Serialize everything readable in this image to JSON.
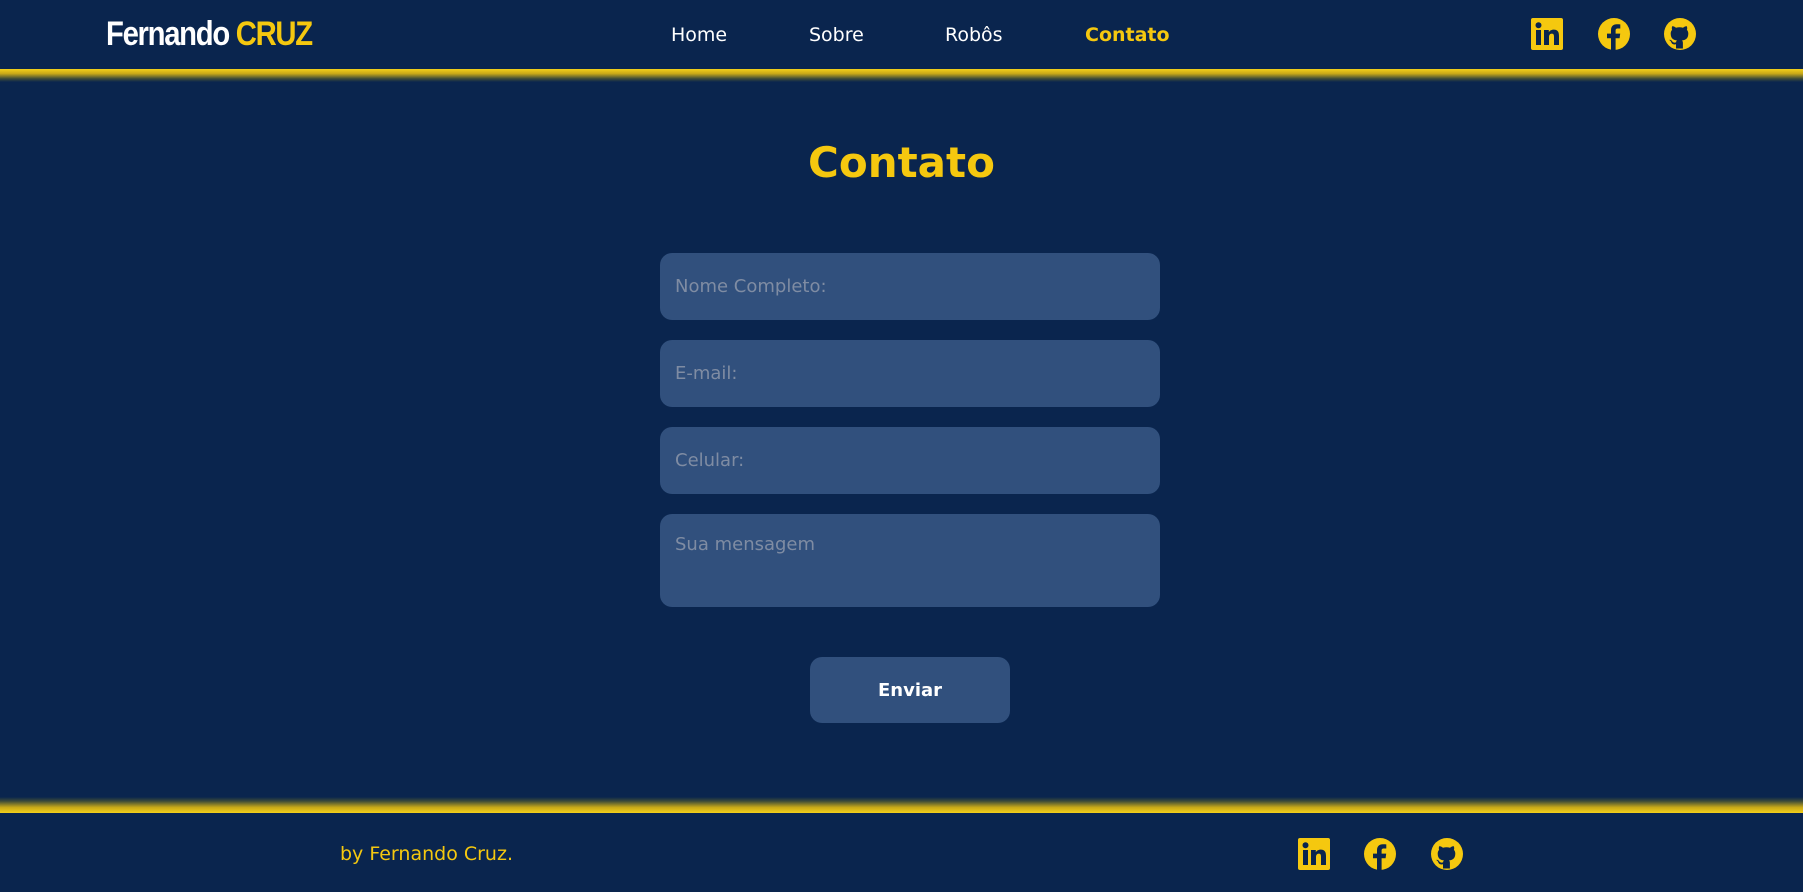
{
  "header": {
    "logo_first": "Fernando",
    "logo_last": "CRUZ",
    "nav": [
      {
        "label": "Home",
        "active": false
      },
      {
        "label": "Sobre",
        "active": false
      },
      {
        "label": "Robôs",
        "active": false
      },
      {
        "label": "Contato",
        "active": true
      }
    ],
    "social_icons": [
      "linkedin-icon",
      "facebook-icon",
      "github-icon"
    ]
  },
  "main": {
    "title": "Contato",
    "form": {
      "name_placeholder": "Nome Completo:",
      "email_placeholder": "E-mail:",
      "phone_placeholder": "Celular:",
      "message_placeholder": "Sua mensagem",
      "submit_label": "Enviar"
    }
  },
  "footer": {
    "credit": "by Fernando Cruz.",
    "social_icons": [
      "linkedin-icon",
      "facebook-icon",
      "github-icon"
    ]
  },
  "colors": {
    "background": "#0a254e",
    "accent": "#f5c80f",
    "field_background": "#31507d",
    "text": "#ffffff"
  }
}
